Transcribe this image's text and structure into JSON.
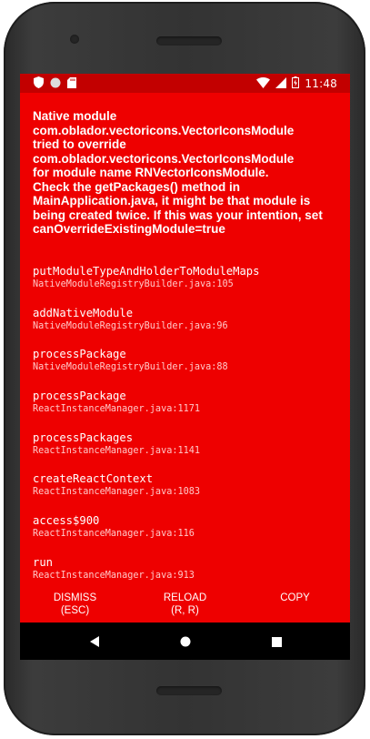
{
  "status_bar": {
    "time": "11:48",
    "left_icons": [
      "shield-icon",
      "circle-icon",
      "sd-card-icon"
    ],
    "right_icons": [
      "wifi-icon",
      "signal-icon",
      "battery-icon"
    ]
  },
  "error": {
    "message_lines": [
      "Native module",
      "com.oblador.vectoricons.VectorIconsModule",
      "tried to override",
      "com.oblador.vectoricons.VectorIconsModule",
      "for module name RNVectorIconsModule.",
      "Check the getPackages() method in",
      "MainApplication.java, it might be that module is",
      "being created twice. If this was your intention, set",
      "canOverrideExistingModule=true"
    ],
    "stack": [
      {
        "method": "putModuleTypeAndHolderToModuleMaps",
        "location": "NativeModuleRegistryBuilder.java:105"
      },
      {
        "method": "addNativeModule",
        "location": "NativeModuleRegistryBuilder.java:96"
      },
      {
        "method": "processPackage",
        "location": "NativeModuleRegistryBuilder.java:88"
      },
      {
        "method": "processPackage",
        "location": "ReactInstanceManager.java:1171"
      },
      {
        "method": "processPackages",
        "location": "ReactInstanceManager.java:1141"
      },
      {
        "method": "createReactContext",
        "location": "ReactInstanceManager.java:1083"
      },
      {
        "method": "access$900",
        "location": "ReactInstanceManager.java:116"
      },
      {
        "method": "run",
        "location": "ReactInstanceManager.java:913"
      }
    ]
  },
  "buttons": {
    "dismiss": {
      "label": "DISMISS",
      "shortcut": "(ESC)"
    },
    "reload": {
      "label": "RELOAD",
      "shortcut": "(R, R)"
    },
    "copy": {
      "label": "COPY"
    }
  },
  "nav": {
    "icons": [
      "back-icon",
      "home-icon",
      "recents-icon"
    ]
  },
  "colors": {
    "redbox": "#ee0000",
    "status_bar": "#c20000",
    "nav_bar": "#000000",
    "device": "#333333"
  }
}
